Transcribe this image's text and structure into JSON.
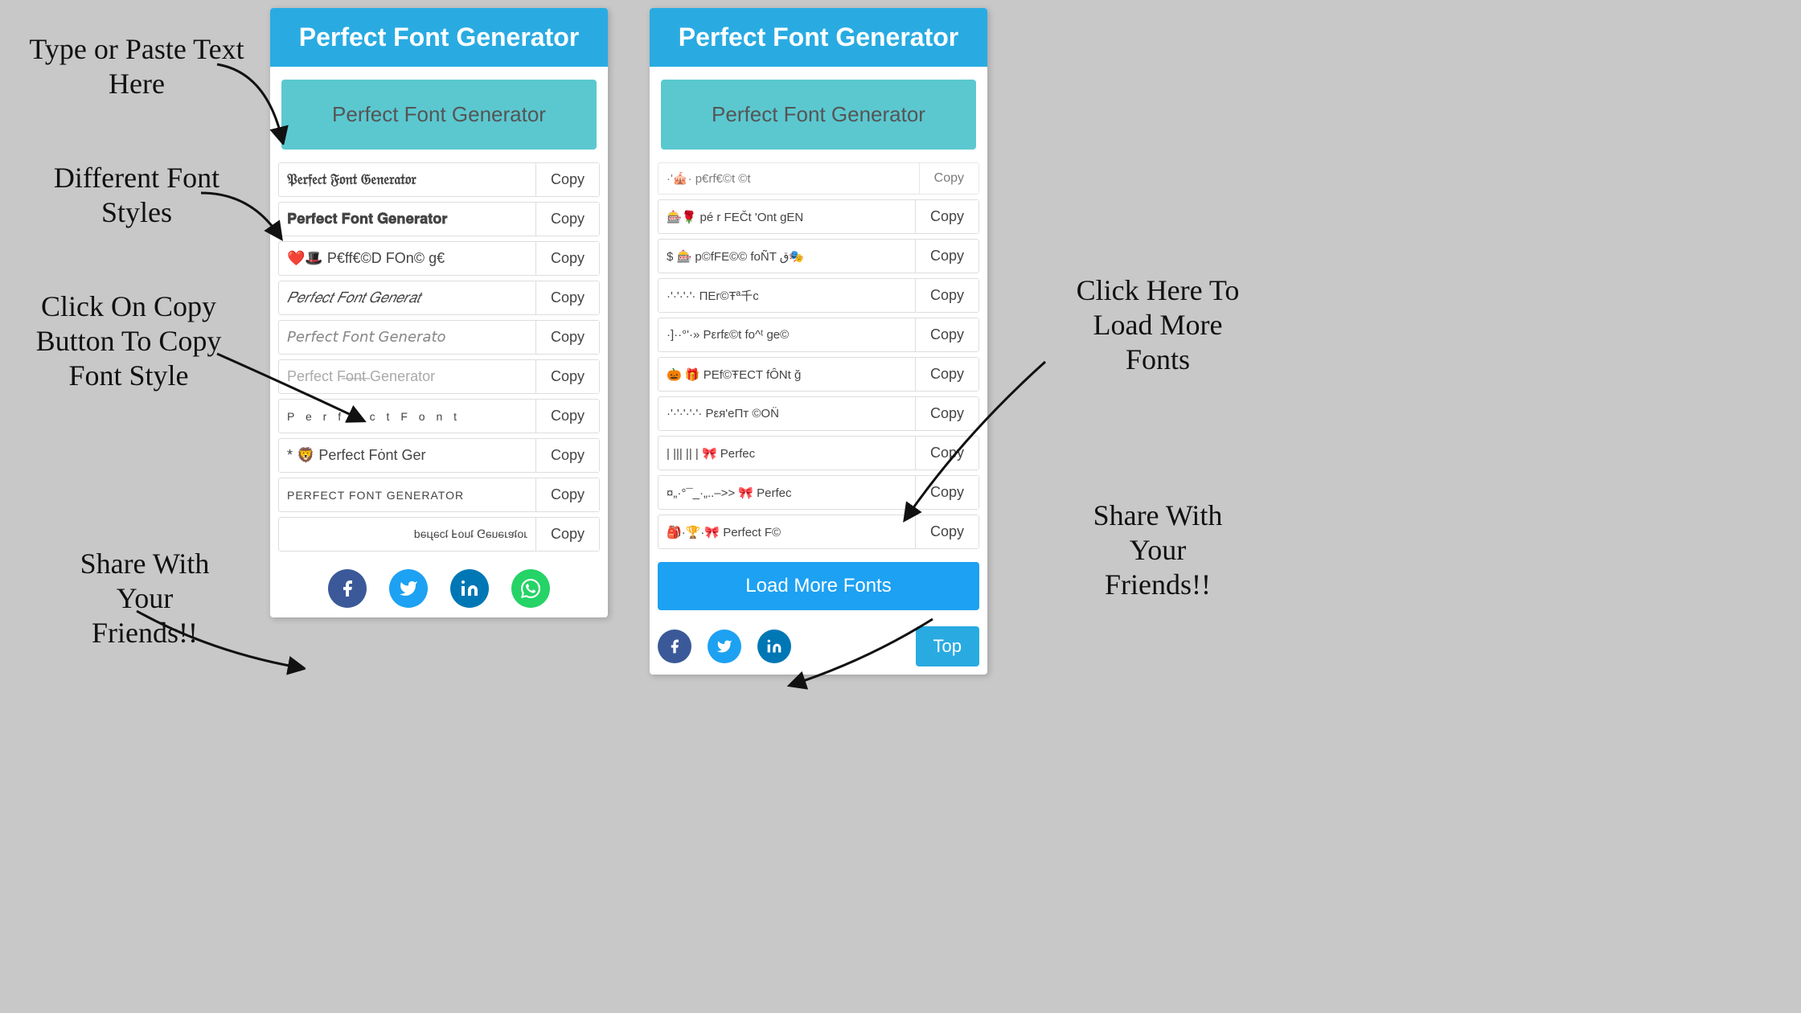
{
  "app": {
    "title": "Perfect Font Generator"
  },
  "annotations": {
    "type_paste": "Type or Paste Text\nHere",
    "different_fonts": "Different Font\nStyles",
    "click_copy": "Click On Copy\nButton To Copy\nFont Style",
    "share_left": "Share With\nYour\nFriends!!",
    "click_load": "Click Here To\nLoad More\nFonts",
    "share_right": "Share With\nYour\nFriends!!"
  },
  "panel1": {
    "header": "Perfect Font Generator",
    "input_placeholder": "Perfect Font Generator",
    "fonts": [
      {
        "text": "𝔓𝔢𝔯𝔣𝔢𝔠𝔱 𝔉𝔬𝔫𝔱 𝔊𝔢𝔫𝔢𝔯𝔞𝔱𝔬𝔯",
        "copy": "Copy"
      },
      {
        "text": "𝐏𝐞𝐫𝐟𝐞𝐜𝐭 𝐅𝐨𝐧𝐭 𝐆𝐞𝐧𝐞𝐫𝐚𝐭𝐨𝐫",
        "copy": "Copy"
      },
      {
        "text": "❤️🎩 P€ff€©D FOn© g€",
        "copy": "Copy"
      },
      {
        "text": "𝑃𝑒𝑟𝑓𝑒𝑐𝑡 𝐹𝑜𝑛𝑡 𝐺𝑒𝑛𝑒𝑟𝑎𝑡",
        "copy": "Copy"
      },
      {
        "text": "𝘗𝘦𝘳𝘧𝘦𝘤𝘵 𝘍𝘰𝘯𝘵 𝘎𝘦𝘯𝘦𝘳𝘢𝘵𝘰",
        "copy": "Copy"
      },
      {
        "text": "Perfect Fon̶t̶ Generator",
        "copy": "Copy"
      },
      {
        "text": "P  e  r  f  e  c  t   F  o  n  t",
        "copy": "Copy"
      },
      {
        "text": "* 🦁 Perfect Fȯnt Ger",
        "copy": "Copy"
      },
      {
        "text": "PERFECT FONT GENERATOR",
        "copy": "Copy"
      },
      {
        "text": "ɹoʇɐɹǝuǝ⅁ ʇuoℲ ʇɔǝɟɹǝd",
        "copy": "Copy"
      }
    ],
    "social": {
      "facebook": "f",
      "twitter": "🐦",
      "linkedin": "in",
      "whatsapp": "w"
    }
  },
  "panel2": {
    "header": "Perfect Font Generator",
    "input_placeholder": "Perfect Font Generator",
    "fonts": [
      {
        "text": "p€ r FEČt 'Ont gEN",
        "copy": "Copy"
      },
      {
        "text": "$ 🎰 p©fFE©© foÑT ق🎭",
        "copy": "Copy"
      },
      {
        "text": "·'·'·'·'· ΠΕr©Ŧª千c",
        "copy": "Copy"
      },
      {
        "text": "·]··°'·»  Ρεrfε©t fo^ᵗ ge©",
        "copy": "Copy"
      },
      {
        "text": "🎃 🎁 ΡEf©ŦECT fÔNt ğ",
        "copy": "Copy"
      },
      {
        "text": "·'·'·'·'·'· Ρεя'еΠт ©ON̈",
        "copy": "Copy"
      },
      {
        "text": "| ||| || | 🎀 Perfec",
        "copy": "Copy"
      },
      {
        "text": "¤„·°¯_·„..–>> 🎀 Perfec",
        "copy": "Copy"
      },
      {
        "text": "🎒·🏆·🎀 Perfect F©",
        "copy": "Copy"
      }
    ],
    "load_more": "Load More Fonts",
    "top_btn": "Top",
    "social": {
      "facebook": "f",
      "twitter": "🐦",
      "linkedin": "in"
    }
  }
}
